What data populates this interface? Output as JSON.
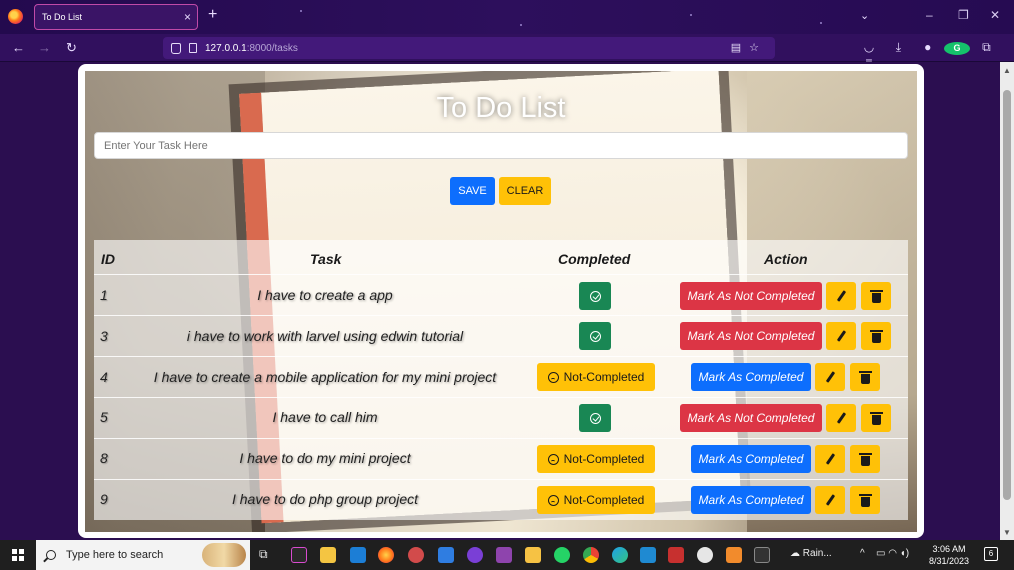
{
  "browser": {
    "tab_title": "To Do List",
    "tab_close": "×",
    "new_tab": "+",
    "url_host": "127.0.0.1",
    "url_path": ":8000/tasks"
  },
  "page": {
    "title": "To Do List",
    "input_placeholder": "Enter Your Task Here",
    "save_label": "SAVE",
    "clear_label": "CLEAR"
  },
  "table": {
    "headers": {
      "id": "ID",
      "task": "Task",
      "completed": "Completed",
      "action": "Action"
    },
    "rows": [
      {
        "id": "1",
        "task": "I have to create a app",
        "completed": true,
        "mark_label": "Mark As Not Completed"
      },
      {
        "id": "3",
        "task": "i have to work with larvel using edwin tutorial",
        "completed": true,
        "mark_label": "Mark As Not Completed"
      },
      {
        "id": "4",
        "task": "I have to create a mobile application for my mini project",
        "completed": false,
        "status_label": "Not-Completed",
        "mark_label": "Mark As Completed"
      },
      {
        "id": "5",
        "task": "I have to call him",
        "completed": true,
        "mark_label": "Mark As Not Completed"
      },
      {
        "id": "8",
        "task": "I have to do my mini project",
        "completed": false,
        "status_label": "Not-Completed",
        "mark_label": "Mark As Completed"
      },
      {
        "id": "9",
        "task": "I have to do php group project",
        "completed": false,
        "status_label": "Not-Completed",
        "mark_label": "Mark As Completed"
      }
    ]
  },
  "taskbar": {
    "search_placeholder": "Type here to search",
    "weather": "Rain...",
    "time": "3:06 AM",
    "date": "8/31/2023",
    "notifications": "6"
  },
  "colors": {
    "primary": "#0d6efd",
    "warning": "#ffc107",
    "success": "#198754",
    "danger": "#dc3545"
  }
}
